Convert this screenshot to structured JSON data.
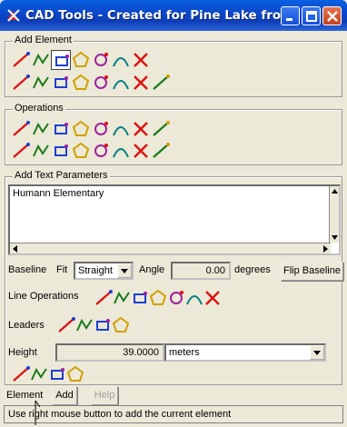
{
  "window": {
    "title": "CAD Tools - Created for Pine Lake fro..."
  },
  "add_element": {
    "title": "Add Element",
    "row1_icons": [
      "line-icon",
      "polyline-icon",
      "text-icon",
      "rectangle-icon",
      "polygon-icon",
      "point-icon",
      "arc-icon"
    ],
    "row2_icons": [
      "arc-3pt-icon",
      "spline-icon",
      "circle-icon",
      "ellipse-icon",
      "node-icon",
      "route-icon",
      "symbol-icon",
      "edit-element-icon"
    ]
  },
  "operations": {
    "title": "Operations",
    "row1_icons": [
      "select-icon",
      "move-icon",
      "rotate-icon",
      "scale-icon",
      "trim-icon",
      "extend-icon",
      "join-icon",
      "break-icon"
    ],
    "row2_icons": [
      "split-icon",
      "offset-icon",
      "fillet-icon",
      "align-icon",
      "mirror-icon",
      "copy-icon",
      "merge-icon",
      "delete-icon"
    ]
  },
  "text_params": {
    "title": "Add Text Parameters",
    "text_value": "Humann Elementary",
    "baseline_label": "Baseline",
    "fit_label": "Fit",
    "fit_value": "Straight",
    "angle_label": "Angle",
    "angle_value": "0.00",
    "angle_unit": "degrees",
    "flip_baseline": "Flip Baseline",
    "line_operations_label": "Line Operations",
    "leaders_label": "Leaders",
    "height_label": "Height",
    "height_value": "39.0000",
    "height_unit": "meters"
  },
  "element_bar": {
    "element_label": "Element",
    "add_button": "Add",
    "help_button": "Help"
  },
  "status": "Use right mouse button to add the current element"
}
